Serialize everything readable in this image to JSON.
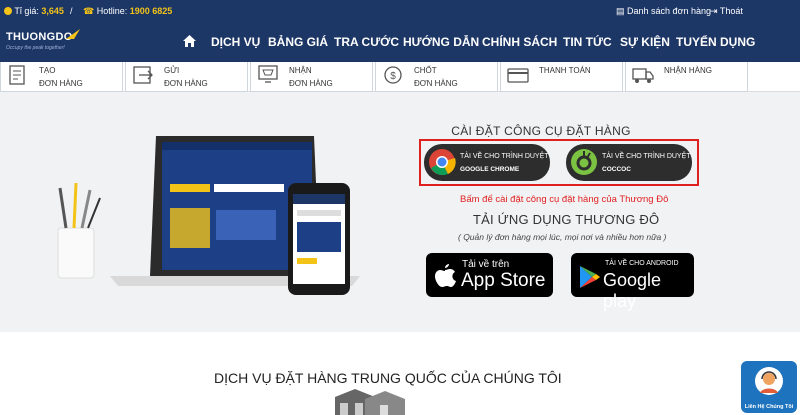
{
  "topbar": {
    "rate_label": "Tỉ giá:",
    "rate_value": "3,645",
    "separator": "/",
    "hotline_label": "Hotline:",
    "hotline_value": "1900 6825",
    "orders_link": "Danh sách đơn hàng",
    "logout_link": "Thoát"
  },
  "logo": {
    "name": "THUONGDO",
    "slogan": "Occupy the peak together!"
  },
  "menu": [
    "DỊCH VỤ",
    "BẢNG GIÁ",
    "TRA CƯỚC",
    "HƯỚNG DẪN",
    "CHÍNH SÁCH",
    "TIN TỨC",
    "SỰ KIỆN",
    "TUYỂN DỤNG"
  ],
  "steps": [
    {
      "line1": "TẠO",
      "line2": "ĐƠN HÀNG"
    },
    {
      "line1": "GỬI",
      "line2": "ĐƠN HÀNG"
    },
    {
      "line1": "NHẬN",
      "line2": "ĐƠN HÀNG"
    },
    {
      "line1": "CHỐT",
      "line2": "ĐƠN HÀNG"
    },
    {
      "line1": "THANH TOÁN",
      "line2": ""
    },
    {
      "line1": "NHẬN HÀNG",
      "line2": ""
    }
  ],
  "install": {
    "title": "CÀI ĐẶT CÔNG CỤ ĐẶT HÀNG",
    "chrome_line1": "TẢI VỀ CHO TRÌNH DUYỆT",
    "chrome_line2": "GOOGLE CHROME",
    "coccoc_line1": "TẢI VỀ CHO TRÌNH DUYỆT",
    "coccoc_line2": "COCCOC",
    "note": "Bấm để cài đặt công cụ đặt hàng của Thương Đô"
  },
  "app": {
    "title": "TẢI ỨNG DỤNG THƯƠNG ĐÔ",
    "subtitle": "( Quản lý đơn hàng mọi lúc, mọi nơi và nhiều hơn nữa )",
    "appstore_line1": "Tải về trên",
    "appstore_line2": "App Store",
    "googleplay_line1": "TẢI VỀ CHO ANDROID",
    "googleplay_line2": "Google play"
  },
  "section_title": "DỊCH VỤ ĐẶT HÀNG TRUNG QUỐC CỦA CHÚNG TÔI",
  "contact_label": "Liên Hệ Chúng Tôi",
  "colors": {
    "navy": "#1c3666",
    "accent_yellow": "#f3c318",
    "red": "#e02020",
    "contact_blue": "#1e73be"
  }
}
